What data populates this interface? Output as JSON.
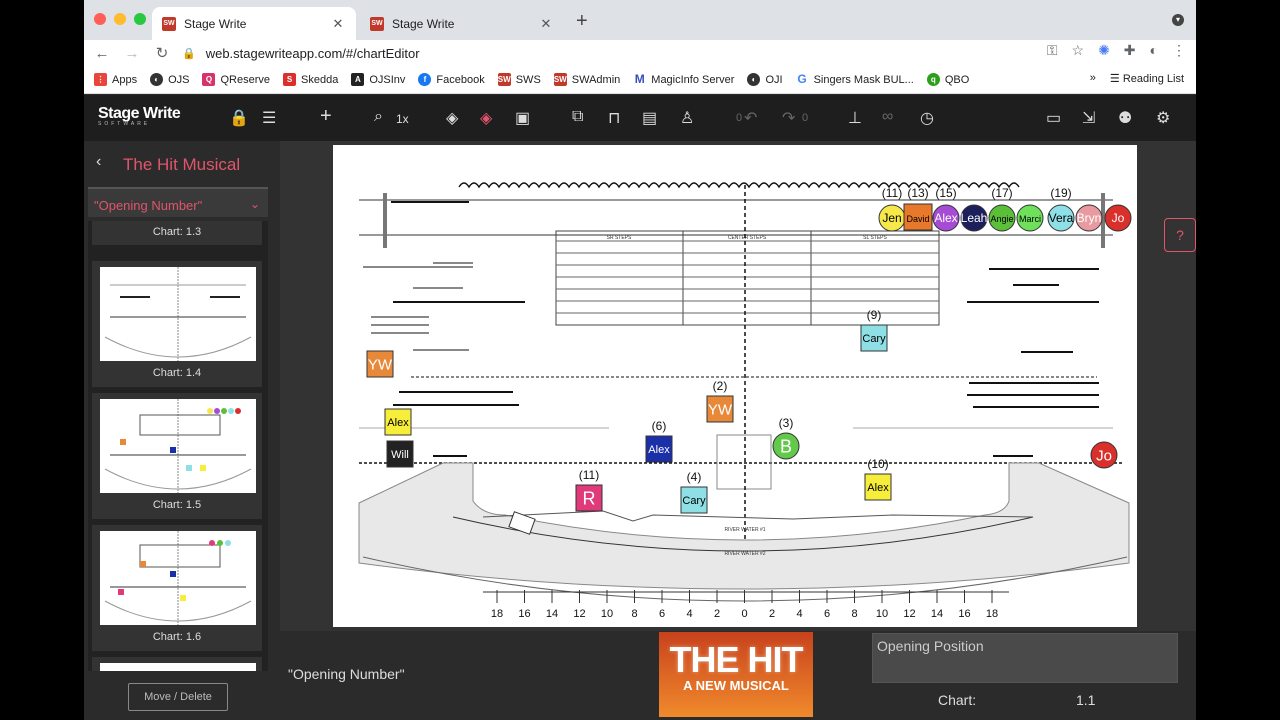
{
  "browser": {
    "tabs": [
      {
        "title": "Stage Write"
      },
      {
        "title": "Stage Write"
      }
    ],
    "url": "web.stagewriteapp.com/#/chartEditor",
    "bookmarks": [
      "Apps",
      "OJS",
      "QReserve",
      "Skedda",
      "OJSInv",
      "Facebook",
      "SWS",
      "SWAdmin",
      "MagicInfo Server",
      "OJI",
      "Singers Mask BUL...",
      "QBO"
    ],
    "more": "»",
    "reading_list": "Reading List"
  },
  "app": {
    "logo": "Stage Write",
    "zoom": "1x",
    "undo_count": "0",
    "redo_count": "0"
  },
  "sidebar": {
    "production": "The Hit Musical",
    "song": "\"Opening Number\"",
    "charts": [
      "Chart: 1.3",
      "Chart: 1.4",
      "Chart: 1.5",
      "Chart: 1.6"
    ],
    "move_delete": "Move / Delete"
  },
  "stage": {
    "ruler": [
      "18",
      "16",
      "14",
      "12",
      "10",
      "8",
      "6",
      "4",
      "2",
      "0",
      "2",
      "4",
      "6",
      "8",
      "10",
      "12",
      "14",
      "16",
      "18"
    ],
    "wing_tokens": [
      {
        "label": "Jen",
        "num": "(11)",
        "color": "#f6e84a",
        "text": "#000"
      },
      {
        "label": "David",
        "num": "(13)",
        "color": "#e8792b",
        "text": "#000",
        "square": true
      },
      {
        "label": "Alex",
        "num": "(15)",
        "color": "#a64bd4",
        "text": "#fff"
      },
      {
        "label": "Leah",
        "num": "",
        "color": "#1d1f5c",
        "text": "#fff"
      },
      {
        "label": "Angie",
        "num": "(17)",
        "color": "#5cbf3a",
        "text": "#000"
      },
      {
        "label": "Marci",
        "num": "",
        "color": "#6ee05a",
        "text": "#000"
      },
      {
        "label": "Vera",
        "num": "(19)",
        "color": "#8fe0e6",
        "text": "#000"
      },
      {
        "label": "Bryn",
        "num": "",
        "color": "#e89aa0",
        "text": "#fff"
      },
      {
        "label": "Jo",
        "num": "",
        "color": "#d9302c",
        "text": "#fff"
      }
    ],
    "performers": [
      {
        "label": "YW",
        "num": "",
        "color": "#e8893a",
        "text": "#fff",
        "shape": "sq"
      },
      {
        "label": "Alex",
        "num": "",
        "color": "#f6ee3a",
        "text": "#000",
        "shape": "sq"
      },
      {
        "label": "Will",
        "num": "",
        "color": "#222",
        "text": "#fff",
        "shape": "sq"
      },
      {
        "label": "Alex",
        "num": "(6)",
        "color": "#1a2fa8",
        "text": "#fff",
        "shape": "sq"
      },
      {
        "label": "YW",
        "num": "(2)",
        "color": "#e8893a",
        "text": "#fff",
        "shape": "sq"
      },
      {
        "label": "B",
        "num": "(3)",
        "color": "#62c94a",
        "text": "#fff",
        "shape": "circle"
      },
      {
        "label": "Cary",
        "num": "(9)",
        "color": "#8fe0e6",
        "text": "#000",
        "shape": "sq"
      },
      {
        "label": "R",
        "num": "(11)",
        "color": "#e03a7a",
        "text": "#fff",
        "shape": "sq"
      },
      {
        "label": "Cary",
        "num": "(4)",
        "color": "#8fe0e6",
        "text": "#000",
        "shape": "sq"
      },
      {
        "label": "Alex",
        "num": "(10)",
        "color": "#f6ee3a",
        "text": "#000",
        "shape": "sq"
      },
      {
        "label": "Jo",
        "num": "",
        "color": "#d9302c",
        "text": "#fff",
        "shape": "circle"
      }
    ],
    "small_labels": [
      "SR STEPS",
      "CENTER STEPS",
      "SL STEPS",
      "RIVER WATER #1",
      "RIVER WATER #2"
    ]
  },
  "bottom": {
    "song": "\"Opening Number\"",
    "poster_title": "THE HIT",
    "poster_sub": "A NEW MUSICAL",
    "position_name": "Opening Position",
    "chart_label": "Chart:",
    "chart_number": "1.1"
  }
}
